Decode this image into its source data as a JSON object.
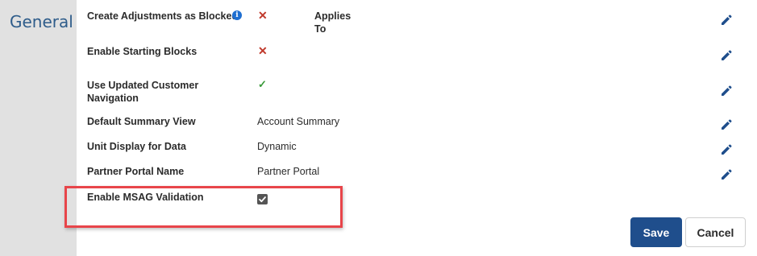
{
  "sidebar": {
    "title": "General"
  },
  "settings": [
    {
      "label": "Create Adjustments as Blocked",
      "status": "x-icon",
      "info": "i"
    },
    {
      "label": "Enable Starting Blocks",
      "status": "x-icon"
    },
    {
      "label_line1": "Use Updated Customer",
      "label_line2": "Navigation",
      "status": "check-icon"
    },
    {
      "label": "Default Summary View",
      "value": "Account Summary"
    },
    {
      "label": "Unit Display for Data",
      "value": "Dynamic"
    },
    {
      "label": "Partner Portal Name",
      "value": "Partner Portal"
    },
    {
      "label": "Enable MSAG Validation",
      "checked": true
    }
  ],
  "applies_to": {
    "line1": "Applies",
    "line2": "To"
  },
  "icons": {
    "x": "✕",
    "check": "✓"
  },
  "buttons": {
    "save": "Save",
    "cancel": "Cancel"
  },
  "colors": {
    "primary": "#1f4e8c",
    "highlight": "#e8454a",
    "x_red": "#c0392b",
    "check_green": "#3a9a3a",
    "info_blue": "#1f6fd1"
  }
}
